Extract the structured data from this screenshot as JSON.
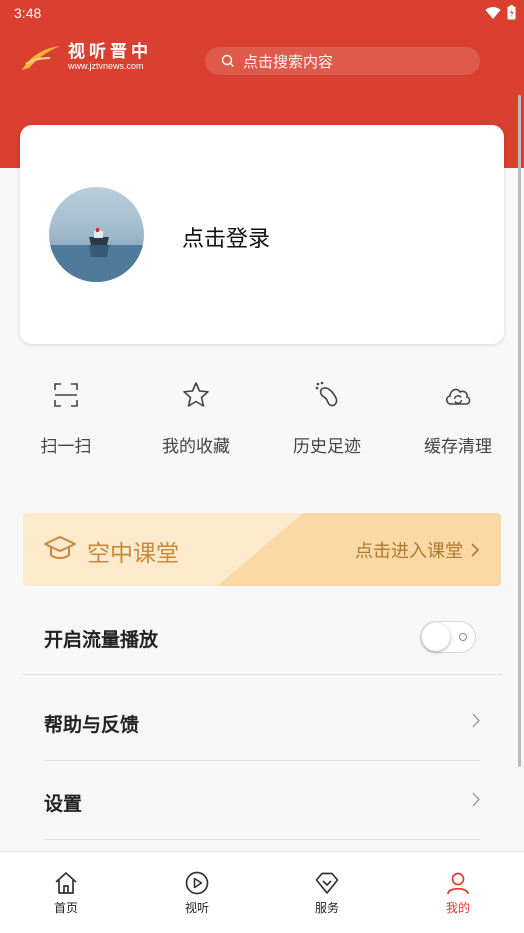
{
  "status_bar": {
    "time": "3:48"
  },
  "header": {
    "logo_name": "视听晋中",
    "logo_url": "www.jztvnews.com",
    "search_placeholder": "点击搜索内容"
  },
  "profile": {
    "login_text": "点击登录"
  },
  "quick_actions": [
    {
      "label": "扫一扫",
      "icon": "scan-icon"
    },
    {
      "label": "我的收藏",
      "icon": "star-icon"
    },
    {
      "label": "历史足迹",
      "icon": "footprint-icon"
    },
    {
      "label": "缓存清理",
      "icon": "cloud-refresh-icon"
    }
  ],
  "banner": {
    "title": "空中课堂",
    "enter": "点击进入课堂"
  },
  "menu": {
    "traffic_play": "开启流量播放",
    "traffic_play_enabled": false,
    "help": "帮助与反馈",
    "settings": "设置"
  },
  "tabbar": {
    "items": [
      {
        "label": "首页",
        "icon": "home-icon"
      },
      {
        "label": "视听",
        "icon": "play-icon"
      },
      {
        "label": "服务",
        "icon": "diamond-heart-icon"
      },
      {
        "label": "我的",
        "icon": "user-icon"
      }
    ],
    "active_index": 3
  },
  "colors": {
    "brand": "#d9402f",
    "banner_bg": "#fdeacd",
    "banner_accent": "#fbd9a6",
    "banner_text": "#c88a3a"
  }
}
